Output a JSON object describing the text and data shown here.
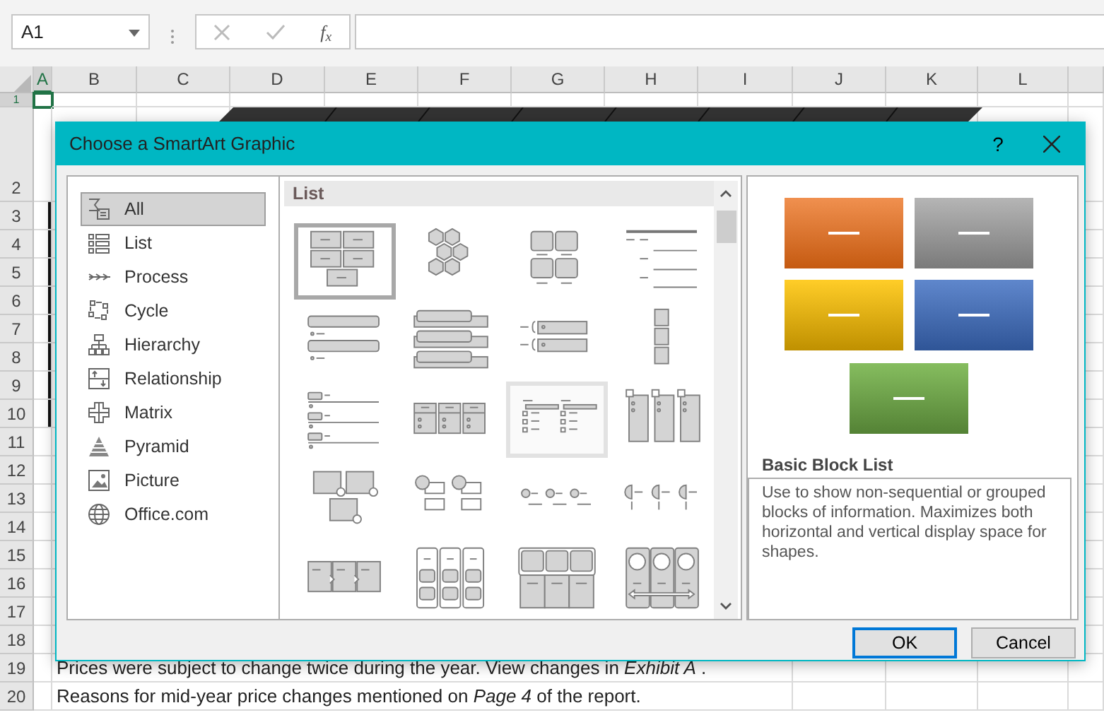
{
  "name_box": {
    "value": "A1"
  },
  "formula_buttons": {
    "function_label": "f$_{x}$"
  },
  "columns": [
    {
      "label": "A",
      "selected": true
    },
    {
      "label": "B",
      "selected": false
    },
    {
      "label": "C",
      "selected": false
    },
    {
      "label": "D",
      "selected": false
    },
    {
      "label": "E",
      "selected": false
    },
    {
      "label": "F",
      "selected": false
    },
    {
      "label": "G",
      "selected": false
    },
    {
      "label": "H",
      "selected": false
    },
    {
      "label": "I",
      "selected": false
    },
    {
      "label": "J",
      "selected": false
    },
    {
      "label": "K",
      "selected": false
    },
    {
      "label": "L",
      "selected": false
    }
  ],
  "rows": [
    {
      "label": "1",
      "selected": true
    },
    {
      "label": "2",
      "selected": false
    },
    {
      "label": "3",
      "selected": false
    },
    {
      "label": "4",
      "selected": false
    },
    {
      "label": "5",
      "selected": false
    },
    {
      "label": "6",
      "selected": false
    },
    {
      "label": "7",
      "selected": false
    },
    {
      "label": "8",
      "selected": false
    },
    {
      "label": "9",
      "selected": false
    },
    {
      "label": "10",
      "selected": false
    },
    {
      "label": "11",
      "selected": false
    },
    {
      "label": "12",
      "selected": false
    },
    {
      "label": "13",
      "selected": false
    },
    {
      "label": "14",
      "selected": false
    },
    {
      "label": "15",
      "selected": false
    },
    {
      "label": "16",
      "selected": false
    },
    {
      "label": "17",
      "selected": false
    },
    {
      "label": "18",
      "selected": false
    },
    {
      "label": "19",
      "selected": false,
      "text": "Prices were subject to change twice during the year. View changes in *Exhibit A* ."
    },
    {
      "label": "20",
      "selected": false,
      "text": "Reasons for mid-year price changes mentioned on *Page 4* of the report."
    }
  ],
  "dialog": {
    "title": "Choose a SmartArt Graphic",
    "help": "?",
    "categories": [
      {
        "label": "All",
        "selected": true
      },
      {
        "label": "List",
        "selected": false
      },
      {
        "label": "Process",
        "selected": false
      },
      {
        "label": "Cycle",
        "selected": false
      },
      {
        "label": "Hierarchy",
        "selected": false
      },
      {
        "label": "Relationship",
        "selected": false
      },
      {
        "label": "Matrix",
        "selected": false
      },
      {
        "label": "Pyramid",
        "selected": false
      },
      {
        "label": "Picture",
        "selected": false
      },
      {
        "label": "Office.com",
        "selected": false
      }
    ],
    "gallery": {
      "header": "List",
      "layouts": [
        {
          "selected": true,
          "hovered": false
        },
        {
          "selected": false,
          "hovered": false
        },
        {
          "selected": false,
          "hovered": false
        },
        {
          "selected": false,
          "hovered": false
        },
        {
          "selected": false,
          "hovered": false
        },
        {
          "selected": false,
          "hovered": false
        },
        {
          "selected": false,
          "hovered": false
        },
        {
          "selected": false,
          "hovered": false
        },
        {
          "selected": false,
          "hovered": false
        },
        {
          "selected": false,
          "hovered": false
        },
        {
          "selected": false,
          "hovered": true
        },
        {
          "selected": false,
          "hovered": false
        },
        {
          "selected": false,
          "hovered": false
        },
        {
          "selected": false,
          "hovered": false
        },
        {
          "selected": false,
          "hovered": false
        },
        {
          "selected": false,
          "hovered": false
        },
        {
          "selected": false,
          "hovered": false
        },
        {
          "selected": false,
          "hovered": false
        },
        {
          "selected": false,
          "hovered": false
        },
        {
          "selected": false,
          "hovered": false
        }
      ]
    },
    "preview": {
      "title": "Basic Block List",
      "description": "Use to show non-sequential or grouped blocks of information. Maximizes both horizontal and vertical display space for shapes."
    },
    "buttons": [
      {
        "label": "OK",
        "default": true
      },
      {
        "label": "Cancel",
        "default": false
      }
    ]
  }
}
